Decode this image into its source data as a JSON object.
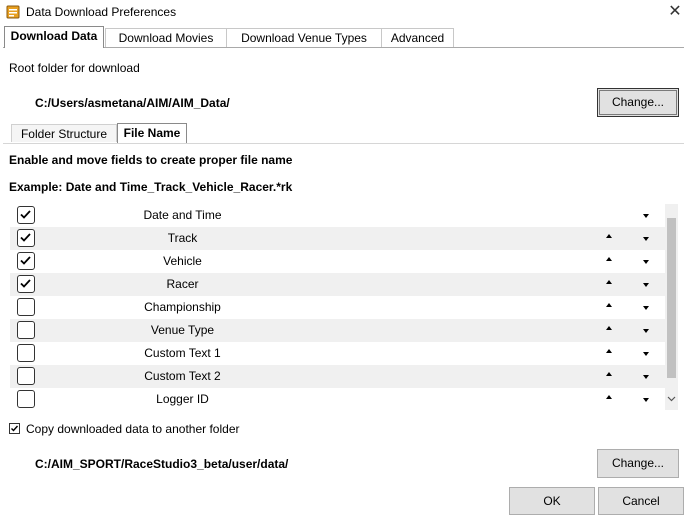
{
  "window": {
    "title": "Data Download Preferences",
    "close_glyph": "✕"
  },
  "tabs": [
    {
      "label": "Download Data",
      "active": true
    },
    {
      "label": "Download Movies",
      "active": false
    },
    {
      "label": "Download Venue Types",
      "active": false
    },
    {
      "label": "Advanced",
      "active": false
    }
  ],
  "root_folder": {
    "label": "Root folder for download",
    "path": "C:/Users/asmetana/AIM/AIM_Data/",
    "change_label": "Change..."
  },
  "subtabs": [
    {
      "label": "Folder Structure",
      "active": false
    },
    {
      "label": "File Name",
      "active": true
    }
  ],
  "instructions": "Enable and move fields to create proper file name",
  "example": "Example: Date and Time_Track_Vehicle_Racer.*rk",
  "fields": [
    {
      "label": "Date and Time",
      "checked": true
    },
    {
      "label": "Track",
      "checked": true
    },
    {
      "label": "Vehicle",
      "checked": true
    },
    {
      "label": "Racer",
      "checked": true
    },
    {
      "label": "Championship",
      "checked": false
    },
    {
      "label": "Venue Type",
      "checked": false
    },
    {
      "label": "Custom Text 1",
      "checked": false
    },
    {
      "label": "Custom Text 2",
      "checked": false
    },
    {
      "label": "Logger ID",
      "checked": false
    }
  ],
  "copy_option": {
    "label": "Copy downloaded data to another folder",
    "checked": true,
    "path": "C:/AIM_SPORT/RaceStudio3_beta/user/data/",
    "change_label": "Change..."
  },
  "footer": {
    "ok_label": "OK",
    "cancel_label": "Cancel"
  },
  "colors": {
    "row_alt": "#f0f0f0",
    "button": "#e1e1e1",
    "icon": "#e8a020"
  }
}
